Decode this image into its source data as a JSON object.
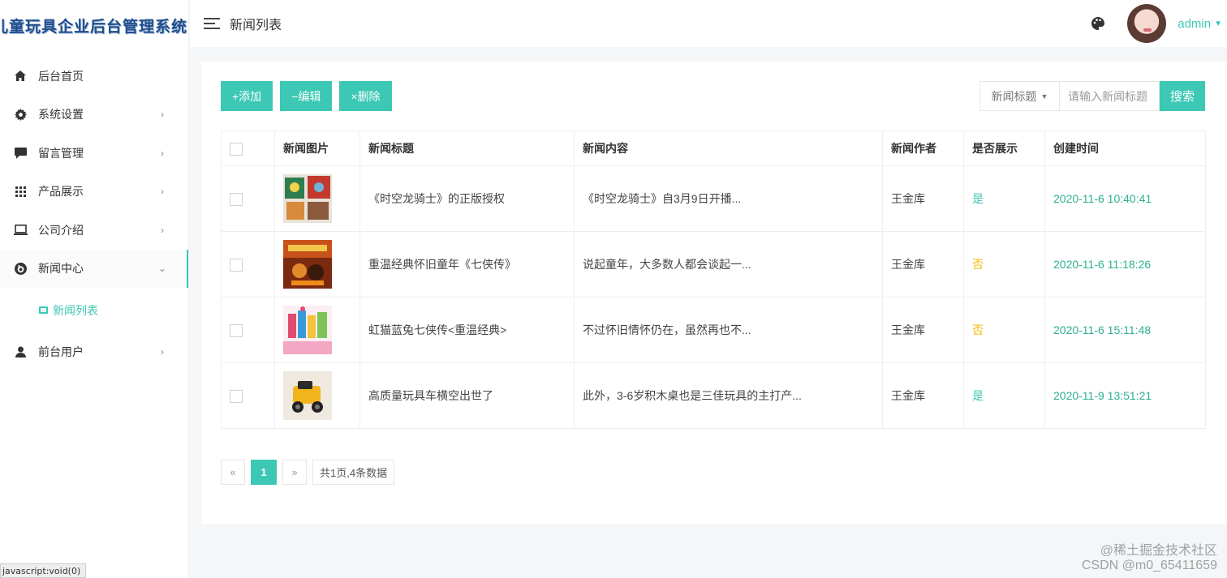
{
  "sidebar": {
    "brand": "儿童玩具企业后台管理系统",
    "items": [
      {
        "label": "后台首页",
        "icon": "home-icon",
        "chevron": ""
      },
      {
        "label": "系统设置",
        "icon": "gear-icon",
        "chevron": "›"
      },
      {
        "label": "留言管理",
        "icon": "message-icon",
        "chevron": "›"
      },
      {
        "label": "产品展示",
        "icon": "grid-icon",
        "chevron": "›"
      },
      {
        "label": "公司介绍",
        "icon": "laptop-icon",
        "chevron": "›"
      },
      {
        "label": "新闻中心",
        "icon": "news-icon",
        "chevron": "⌄"
      },
      {
        "label": "前台用户",
        "icon": "user-icon",
        "chevron": "›"
      }
    ],
    "sub_item": "新闻列表"
  },
  "header": {
    "title": "新闻列表",
    "user": "admin"
  },
  "toolbar": {
    "add": "+添加",
    "edit": "−编辑",
    "delete": "×删除"
  },
  "search": {
    "type_label": "新闻标题",
    "placeholder": "请输入新闻标题",
    "button": "搜索"
  },
  "table": {
    "columns": [
      "新闻图片",
      "新闻标题",
      "新闻内容",
      "新闻作者",
      "是否展示",
      "创建时间"
    ],
    "rows": [
      {
        "title": "《时空龙骑士》的正版授权",
        "content": "《时空龙骑士》自3月9日开播...",
        "author": "王金库",
        "show": "是",
        "created": "2020-11-6 10:40:41"
      },
      {
        "title": "重温经典怀旧童年《七侠传》",
        "content": "说起童年，大多数人都会谈起一...",
        "author": "王金库",
        "show": "否",
        "created": "2020-11-6 11:18:26"
      },
      {
        "title": "虹猫蓝兔七侠传<重温经典>",
        "content": "不过怀旧情怀仍在，虽然再也不...",
        "author": "王金库",
        "show": "否",
        "created": "2020-11-6 15:11:48"
      },
      {
        "title": "高质量玩具车横空出世了",
        "content": "此外，3-6岁积木桌也是三佳玩具的主打产...",
        "author": "王金库",
        "show": "是",
        "created": "2020-11-9 13:51:21"
      }
    ]
  },
  "pager": {
    "prev": "«",
    "current": "1",
    "next": "»",
    "info": "共1页,4条数据"
  },
  "status_bar": "javascript:void(0)",
  "watermark": {
    "line1": "@稀土掘金技术社区",
    "line2": "CSDN @m0_65411659"
  },
  "colors": {
    "accent": "#3cc8b4",
    "no_status": "#f5b800"
  }
}
